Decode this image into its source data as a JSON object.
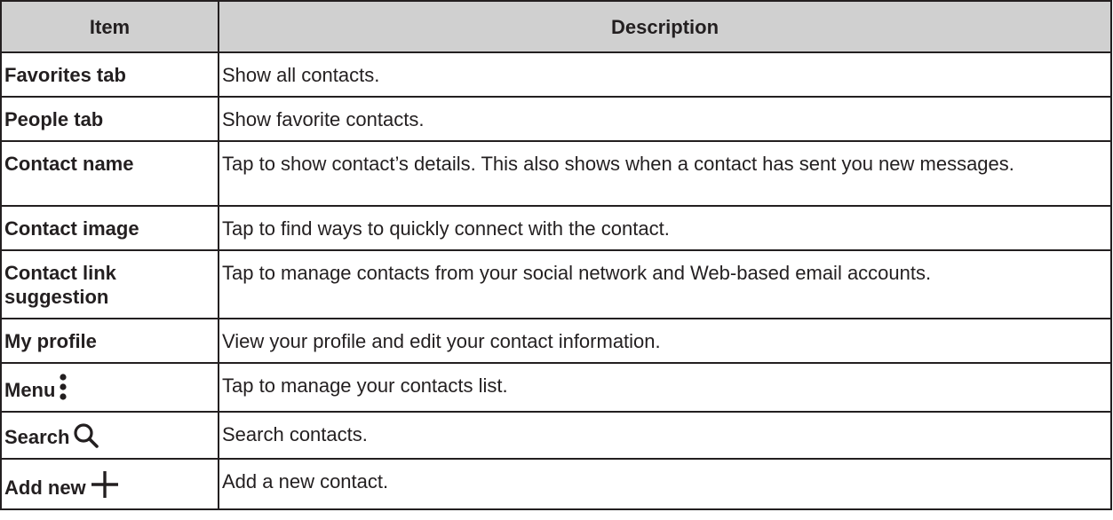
{
  "table": {
    "headers": {
      "item": "Item",
      "description": "Description"
    },
    "rows": [
      {
        "item": "Favorites tab",
        "description": "Show all contacts."
      },
      {
        "item": "People tab",
        "description": "Show favorite contacts."
      },
      {
        "item": "Contact name",
        "description": "Tap to show contact’s details. This also shows when a contact has sent you new messages."
      },
      {
        "item": "Contact image",
        "description": "Tap to find ways to quickly connect with the contact."
      },
      {
        "item": "Contact link suggestion",
        "description": "Tap to manage contacts from your social network and Web-based email accounts."
      },
      {
        "item": "My profile",
        "description": "View your profile and edit your contact information."
      },
      {
        "item": "Menu",
        "icon": "menu-icon",
        "description": "Tap to manage your contacts list."
      },
      {
        "item": "Search",
        "icon": "search-icon",
        "description": "Search contacts."
      },
      {
        "item": "Add new",
        "icon": "plus-icon",
        "description": "Add a new contact."
      }
    ]
  },
  "colors": {
    "header_background": "#d0d0d0",
    "border": "#231f20",
    "text": "#231f20"
  }
}
